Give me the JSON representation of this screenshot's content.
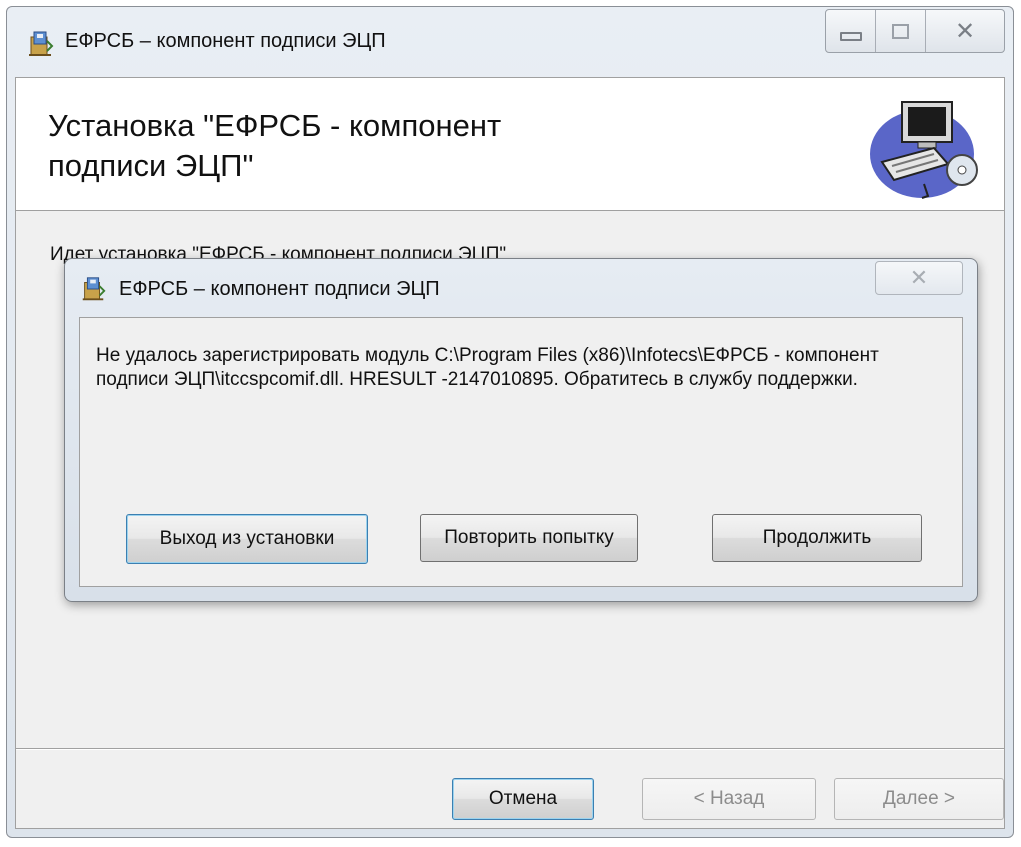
{
  "window": {
    "title": "ЕФРСБ – компонент подписи ЭЦП",
    "caption_buttons": [
      "minimize",
      "maximize",
      "close"
    ]
  },
  "installer": {
    "header_title_line1": "Установка \"ЕФРСБ - компонент",
    "header_title_line2": "подписи ЭЦП\"",
    "status_text": "Идет установка \"ЕФРСБ - компонент подписи ЭЦП\"",
    "buttons": {
      "cancel": "Отмена",
      "back": "< Назад",
      "next": "Далее >"
    }
  },
  "dialog": {
    "title": "ЕФРСБ – компонент подписи ЭЦП",
    "message": "Не удалось зарегистрировать модуль C:\\Program Files (x86)\\Infotecs\\ЕФРСБ - компонент подписи ЭЦП\\itccspcomif.dll. HRESULT -2147010895. Обратитесь в службу поддержки.",
    "buttons": {
      "abort": "Выход из установки",
      "retry": "Повторить попытку",
      "ignore": "Продолжить"
    }
  },
  "icons": {
    "app": "installer-box-icon",
    "banner": "computer-with-disc-icon",
    "close": "close-icon"
  },
  "colors": {
    "default_button_border": "#3c7fb1",
    "window_frame": "#dde4ec",
    "client_background": "#f0f0f0"
  }
}
